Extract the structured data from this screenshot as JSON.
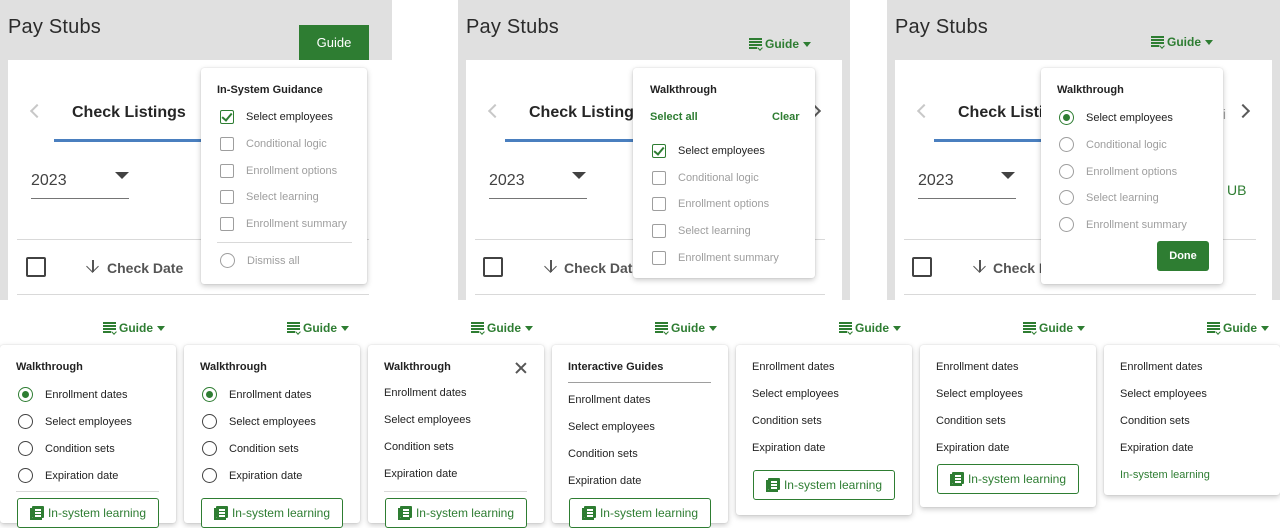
{
  "panel1": {
    "title": "Pay Stubs",
    "guide_button": "Guide",
    "tab": "Check Listings",
    "year": "2023",
    "column_header": "Check Date",
    "menu": {
      "title": "In-System Guidance",
      "items": [
        {
          "label": "Select employees",
          "checked": true
        },
        {
          "label": "Conditional logic",
          "checked": false
        },
        {
          "label": "Enrollment options",
          "checked": false
        },
        {
          "label": "Select learning",
          "checked": false
        },
        {
          "label": "Enrollment summary",
          "checked": false
        }
      ],
      "dismiss": "Dismiss all"
    }
  },
  "panel2": {
    "title": "Pay Stubs",
    "guide_link": "Guide",
    "tab": "Check Listings",
    "year": "2023",
    "column_header": "Check Date",
    "menu": {
      "title": "Walkthrough",
      "select_all": "Select all",
      "clear": "Clear",
      "items": [
        {
          "label": "Select employees",
          "checked": true
        },
        {
          "label": "Conditional logic",
          "checked": false
        },
        {
          "label": "Enrollment options",
          "checked": false
        },
        {
          "label": "Select learning",
          "checked": false
        },
        {
          "label": "Enrollment summary",
          "checked": false
        }
      ]
    }
  },
  "panel3": {
    "title": "Pay Stubs",
    "guide_link": "Guide",
    "tab": "Check Listi",
    "tab_next_partial": "ti",
    "year": "2023",
    "column_header": "Check D",
    "side_text": "UB",
    "menu": {
      "title": "Walkthrough",
      "items": [
        {
          "label": "Select employees",
          "selected": true
        },
        {
          "label": "Conditional logic",
          "selected": false
        },
        {
          "label": "Enrollment options",
          "selected": false
        },
        {
          "label": "Select learning",
          "selected": false
        },
        {
          "label": "Enrollment summary",
          "selected": false
        }
      ],
      "done": "Done"
    }
  },
  "variants": [
    {
      "guide": "Guide",
      "title": "Walkthrough",
      "items": [
        "Enrollment dates",
        "Select employees",
        "Condition sets",
        "Expiration date"
      ],
      "button": "In-system learning"
    },
    {
      "guide": "Guide",
      "title": "Walkthrough",
      "items": [
        "Enrollment dates",
        "Select employees",
        "Condition sets",
        "Expiration date"
      ],
      "button": "In-system learning"
    },
    {
      "guide": "Guide",
      "title": "Walkthrough",
      "items": [
        "Enrollment dates",
        "Select employees",
        "Condition sets",
        "Expiration date"
      ],
      "button": "In-system learning"
    },
    {
      "guide": "Guide",
      "title": "Interactive Guides",
      "items": [
        "Enrollment dates",
        "Select employees",
        "Condition sets",
        "Expiration date"
      ],
      "button": "In-system learning"
    },
    {
      "guide": "Guide",
      "items": [
        "Enrollment dates",
        "Select employees",
        "Condition sets",
        "Expiration date"
      ],
      "button": "In-system learning"
    },
    {
      "guide": "Guide",
      "items": [
        "Enrollment dates",
        "Select employees",
        "Condition sets",
        "Expiration date"
      ],
      "button": "In-system learning"
    },
    {
      "guide": "Guide",
      "items": [
        "Enrollment dates",
        "Select employees",
        "Condition sets",
        "Expiration date"
      ],
      "link": "In-system learning"
    }
  ],
  "colors": {
    "accent": "#2e7d32",
    "tab_underline": "#4a7fbf",
    "background_gray": "#e0e0e0"
  },
  "icons": [
    "check-icon",
    "radio-icon",
    "caret-down-icon",
    "chevron-left-icon",
    "chevron-right-icon",
    "guide-list-icon",
    "book-icon",
    "close-icon",
    "arrow-down-icon"
  ]
}
